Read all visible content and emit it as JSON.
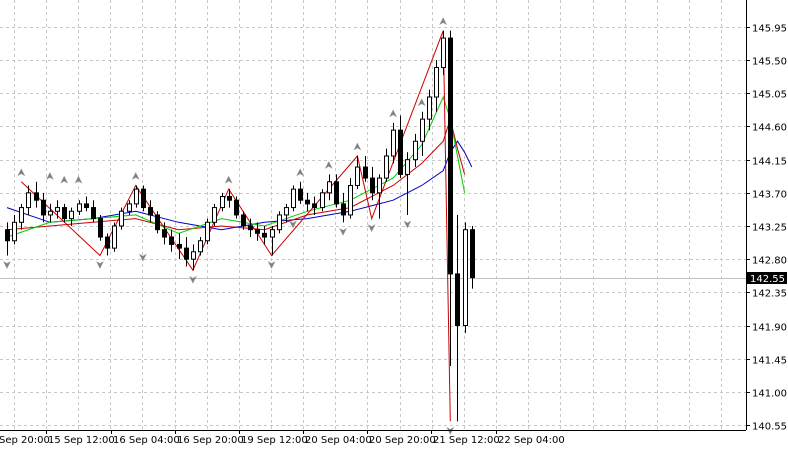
{
  "chart_data": {
    "type": "candlestick",
    "title": "",
    "grid": true,
    "y_axis_position": "right",
    "ylim": [
      140.48,
      146.14
    ],
    "current_price": 142.55,
    "current_price_label": "142.55",
    "y_ticks": [
      "145.95",
      "145.50",
      "145.05",
      "144.60",
      "144.15",
      "143.70",
      "143.25",
      "142.80",
      "142.35",
      "141.90",
      "141.45",
      "141.00",
      "140.55"
    ],
    "x_ticks": [
      "Sep 20:00",
      "15 Sep 12:00",
      "16 Sep 04:00",
      "16 Sep 20:00",
      "19 Sep 12:00",
      "20 Sep 04:00",
      "20 Sep 20:00",
      "21 Sep 12:00",
      "22 Sep 04:00"
    ],
    "colors": {
      "background": "#ffffff",
      "grid": "#c8c8c8",
      "candle": "#000000",
      "zigzag": "#cc0000",
      "ma_fast": "#00cc00",
      "ma_medium": "#cc0000",
      "ma_slow": "#0000cc",
      "fractal": "#808080",
      "price_line": "#c0c0c0",
      "price_badge": "#000000"
    },
    "series": [
      {
        "kind": "candles",
        "values": [
          [
            143.2,
            143.3,
            142.85,
            143.05
          ],
          [
            143.05,
            143.4,
            143.0,
            143.3
          ],
          [
            143.3,
            143.55,
            143.2,
            143.5
          ],
          [
            143.5,
            143.8,
            143.4,
            143.7
          ],
          [
            143.7,
            143.85,
            143.5,
            143.6
          ],
          [
            143.6,
            143.7,
            143.3,
            143.4
          ],
          [
            143.4,
            143.55,
            143.3,
            143.45
          ],
          [
            143.45,
            143.6,
            143.35,
            143.5
          ],
          [
            143.5,
            143.55,
            143.3,
            143.35
          ],
          [
            143.35,
            143.5,
            143.25,
            143.45
          ],
          [
            143.45,
            143.6,
            143.4,
            143.55
          ],
          [
            143.55,
            143.65,
            143.45,
            143.5
          ],
          [
            143.5,
            143.6,
            143.3,
            143.35
          ],
          [
            143.35,
            143.4,
            143.05,
            143.1
          ],
          [
            143.1,
            143.15,
            142.85,
            142.95
          ],
          [
            142.95,
            143.3,
            142.9,
            143.25
          ],
          [
            143.25,
            143.5,
            143.2,
            143.45
          ],
          [
            143.45,
            143.6,
            143.4,
            143.55
          ],
          [
            143.55,
            143.8,
            143.5,
            143.75
          ],
          [
            143.75,
            143.8,
            143.45,
            143.5
          ],
          [
            143.5,
            143.6,
            143.3,
            143.4
          ],
          [
            143.4,
            143.45,
            143.15,
            143.2
          ],
          [
            143.2,
            143.3,
            143.0,
            143.1
          ],
          [
            143.1,
            143.2,
            142.9,
            143.0
          ],
          [
            143.0,
            143.15,
            142.8,
            142.95
          ],
          [
            142.95,
            143.1,
            142.7,
            142.8
          ],
          [
            142.8,
            143.0,
            142.65,
            142.9
          ],
          [
            142.9,
            143.1,
            142.85,
            143.05
          ],
          [
            143.05,
            143.35,
            143.0,
            143.3
          ],
          [
            143.3,
            143.55,
            143.25,
            143.5
          ],
          [
            143.5,
            143.7,
            143.45,
            143.65
          ],
          [
            143.65,
            143.75,
            143.5,
            143.6
          ],
          [
            143.6,
            143.65,
            143.35,
            143.4
          ],
          [
            143.4,
            143.45,
            143.2,
            143.25
          ],
          [
            143.25,
            143.35,
            143.1,
            143.2
          ],
          [
            143.2,
            143.3,
            143.05,
            143.15
          ],
          [
            143.15,
            143.25,
            143.0,
            143.1
          ],
          [
            143.1,
            143.25,
            142.85,
            143.2
          ],
          [
            143.2,
            143.45,
            143.15,
            143.4
          ],
          [
            143.4,
            143.55,
            143.3,
            143.5
          ],
          [
            143.5,
            143.8,
            143.45,
            143.75
          ],
          [
            143.75,
            143.85,
            143.55,
            143.6
          ],
          [
            143.6,
            143.7,
            143.45,
            143.55
          ],
          [
            143.55,
            143.65,
            143.4,
            143.5
          ],
          [
            143.5,
            143.75,
            143.45,
            143.7
          ],
          [
            143.7,
            143.95,
            143.6,
            143.85
          ],
          [
            143.85,
            143.95,
            143.5,
            143.55
          ],
          [
            143.55,
            143.7,
            143.3,
            143.4
          ],
          [
            143.4,
            143.9,
            143.35,
            143.8
          ],
          [
            143.8,
            144.2,
            143.75,
            144.05
          ],
          [
            144.05,
            144.2,
            143.85,
            143.9
          ],
          [
            143.9,
            144.05,
            143.6,
            143.7
          ],
          [
            143.7,
            143.95,
            143.35,
            143.9
          ],
          [
            143.9,
            144.3,
            143.85,
            144.2
          ],
          [
            144.2,
            144.65,
            144.1,
            144.55
          ],
          [
            144.55,
            144.75,
            143.9,
            143.95
          ],
          [
            143.95,
            144.25,
            143.4,
            144.15
          ],
          [
            144.15,
            144.5,
            144.05,
            144.4
          ],
          [
            144.4,
            144.8,
            144.2,
            144.7
          ],
          [
            144.7,
            145.1,
            144.55,
            145.0
          ],
          [
            145.0,
            145.5,
            144.8,
            145.4
          ],
          [
            145.4,
            145.9,
            145.3,
            145.8
          ],
          [
            145.8,
            145.9,
            141.35,
            142.6
          ],
          [
            142.6,
            143.4,
            140.6,
            141.9
          ],
          [
            141.9,
            143.3,
            141.8,
            143.2
          ],
          [
            143.2,
            143.25,
            142.4,
            142.55
          ]
        ]
      },
      {
        "kind": "zigzag",
        "values": [
          [
            2,
            143.85
          ],
          [
            13,
            142.85
          ],
          [
            18,
            143.8
          ],
          [
            26,
            142.65
          ],
          [
            31,
            143.75
          ],
          [
            37,
            142.85
          ],
          [
            49,
            144.2
          ],
          [
            51,
            143.35
          ],
          [
            61,
            145.9
          ],
          [
            62,
            140.6
          ]
        ]
      },
      {
        "kind": "ma_fast",
        "values": [
          [
            0,
            143.1
          ],
          [
            6,
            143.3
          ],
          [
            12,
            143.35
          ],
          [
            18,
            143.4
          ],
          [
            24,
            143.15
          ],
          [
            30,
            143.35
          ],
          [
            36,
            143.25
          ],
          [
            42,
            143.45
          ],
          [
            48,
            143.6
          ],
          [
            54,
            143.9
          ],
          [
            58,
            144.35
          ],
          [
            61,
            145.0
          ],
          [
            62,
            144.7
          ],
          [
            63,
            144.2
          ],
          [
            64,
            143.7
          ]
        ]
      },
      {
        "kind": "ma_medium",
        "values": [
          [
            0,
            143.2
          ],
          [
            6,
            143.25
          ],
          [
            12,
            143.3
          ],
          [
            18,
            143.35
          ],
          [
            24,
            143.2
          ],
          [
            30,
            143.25
          ],
          [
            36,
            143.2
          ],
          [
            42,
            143.4
          ],
          [
            48,
            143.5
          ],
          [
            54,
            143.8
          ],
          [
            58,
            144.1
          ],
          [
            61,
            144.4
          ],
          [
            62,
            144.7
          ],
          [
            63,
            144.3
          ],
          [
            64,
            143.95
          ]
        ]
      },
      {
        "kind": "ma_slow",
        "values": [
          [
            0,
            143.5
          ],
          [
            6,
            143.3
          ],
          [
            12,
            143.35
          ],
          [
            18,
            143.45
          ],
          [
            24,
            143.3
          ],
          [
            30,
            143.2
          ],
          [
            36,
            143.3
          ],
          [
            42,
            143.35
          ],
          [
            48,
            143.45
          ],
          [
            54,
            143.6
          ],
          [
            58,
            143.8
          ],
          [
            61,
            144.0
          ],
          [
            62,
            144.25
          ],
          [
            63,
            144.4
          ],
          [
            64,
            144.25
          ],
          [
            65,
            144.05
          ]
        ]
      },
      {
        "kind": "fractals_up",
        "values": [
          [
            2,
            143.85
          ],
          [
            6,
            143.8
          ],
          [
            8,
            143.75
          ],
          [
            10,
            143.75
          ],
          [
            18,
            143.8
          ],
          [
            31,
            143.75
          ],
          [
            41,
            143.85
          ],
          [
            45,
            143.95
          ],
          [
            49,
            144.2
          ],
          [
            54,
            144.65
          ],
          [
            58,
            144.8
          ],
          [
            61,
            145.9
          ]
        ]
      },
      {
        "kind": "fractals_down",
        "values": [
          [
            0,
            142.85
          ],
          [
            13,
            142.85
          ],
          [
            19,
            142.95
          ],
          [
            26,
            142.65
          ],
          [
            37,
            142.85
          ],
          [
            40,
            143.4
          ],
          [
            47,
            143.3
          ],
          [
            51,
            143.35
          ],
          [
            56,
            143.4
          ],
          [
            62,
            140.6
          ]
        ]
      }
    ]
  }
}
